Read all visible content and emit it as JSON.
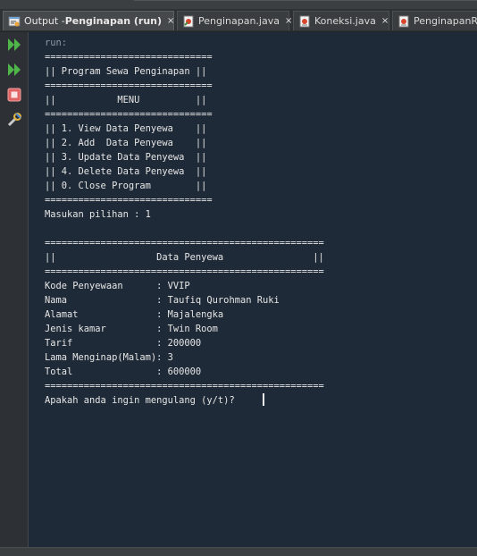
{
  "tabs": [
    {
      "prefix": "Output - ",
      "label": "Penginapan (run)",
      "close": "×"
    },
    {
      "label": "Penginapan.java",
      "close": "×"
    },
    {
      "label": "Koneksi.java",
      "close": "×"
    },
    {
      "label": "PenginapanRep"
    }
  ],
  "sidebar": {
    "icons": [
      "rerun-icon",
      "rerun-with-args-icon",
      "stop-icon",
      "settings-icon"
    ]
  },
  "console": {
    "lines": [
      "run:",
      "==============================",
      "|| Program Sewa Penginapan ||",
      "==============================",
      "||           MENU          ||",
      "==============================",
      "|| 1. View Data Penyewa    ||",
      "|| 2. Add  Data Penyewa    ||",
      "|| 3. Update Data Penyewa  ||",
      "|| 4. Delete Data Penyewa  ||",
      "|| 0. Close Program        ||",
      "==============================",
      "Masukan pilihan : 1",
      "",
      "==================================================",
      "||                  Data Penyewa                ||",
      "==================================================",
      "Kode Penyewaan      : VVIP",
      "Nama                : Taufiq Qurohman Ruki",
      "Alamat              : Majalengka",
      "Jenis kamar         : Twin Room",
      "Tarif               : 200000",
      "Lama Menginap(Malam): 3",
      "Total               : 600000",
      "==================================================",
      "Apakah anda ingin mengulang (y/t)? "
    ]
  }
}
